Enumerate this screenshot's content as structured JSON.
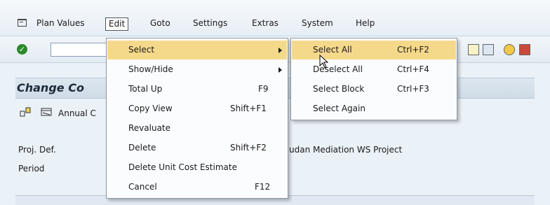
{
  "menubar": {
    "items": [
      {
        "label": "Plan Values"
      },
      {
        "label": "Edit"
      },
      {
        "label": "Goto"
      },
      {
        "label": "Settings"
      },
      {
        "label": "Extras"
      },
      {
        "label": "System"
      },
      {
        "label": "Help"
      }
    ]
  },
  "page": {
    "title": "Change Co",
    "annual_label": "Annual C",
    "fields": [
      {
        "label": "Proj. Def.",
        "value": "udan Mediation WS Project"
      },
      {
        "label": "Period",
        "value": ""
      }
    ]
  },
  "edit_menu": {
    "items": [
      {
        "label": "Select",
        "shortcut": "",
        "submenu": true
      },
      {
        "label": "Show/Hide",
        "shortcut": "",
        "submenu": true
      },
      {
        "label": "Total Up",
        "shortcut": "F9"
      },
      {
        "label": "Copy View",
        "shortcut": "Shift+F1"
      },
      {
        "label": "Revaluate",
        "shortcut": ""
      },
      {
        "label": "Delete",
        "shortcut": "Shift+F2"
      },
      {
        "label": "Delete Unit Cost Estimate",
        "shortcut": ""
      },
      {
        "label": "Cancel",
        "shortcut": "F12"
      }
    ]
  },
  "select_submenu": {
    "items": [
      {
        "label": "Select All",
        "shortcut": "Ctrl+F2"
      },
      {
        "label": "Deselect All",
        "shortcut": "Ctrl+F4"
      },
      {
        "label": "Select Block",
        "shortcut": "Ctrl+F3"
      },
      {
        "label": "Select Again",
        "shortcut": ""
      }
    ]
  },
  "colors": {
    "highlight": "#f5d98b",
    "background": "#eaf1f7"
  }
}
